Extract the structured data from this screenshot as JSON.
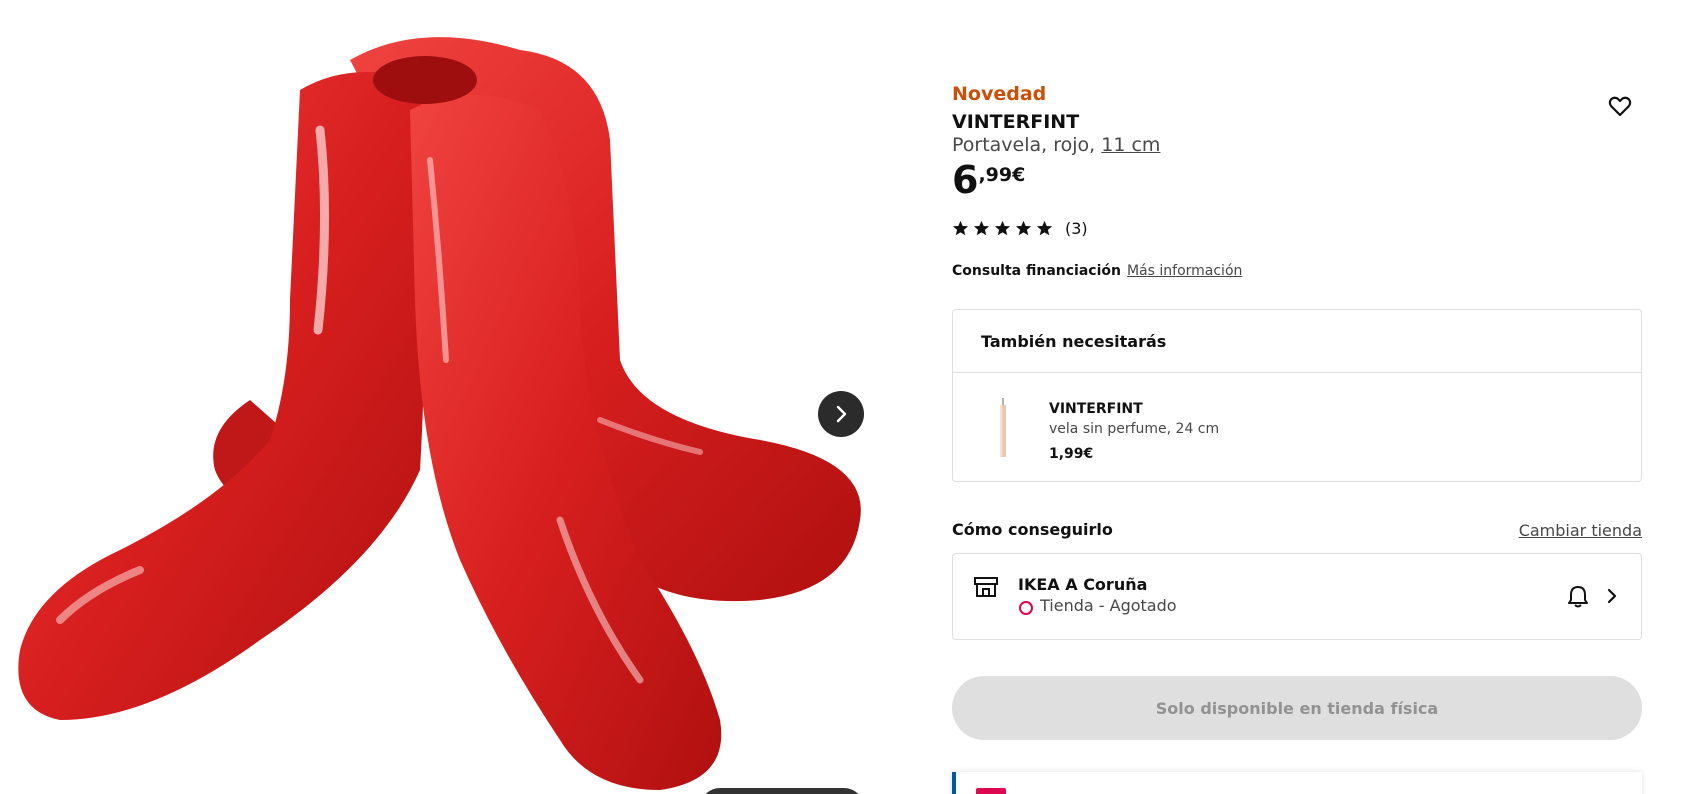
{
  "product": {
    "badge": "Novedad",
    "name": "VINTERFINT",
    "description": "Portavela, rojo, ",
    "size_link": "11 cm",
    "price_integer": "6",
    "price_decimal": ",99€",
    "rating": {
      "stars": 5,
      "max_stars": 5,
      "count_label": "(3)"
    },
    "image_icon": "candle-holder-photo"
  },
  "financing": {
    "label": "Consulta financiación",
    "link": "Más información"
  },
  "also_needed": {
    "title": "También necesitarás",
    "items": [
      {
        "name": "VINTERFINT",
        "description": "vela sin perfume, 24 cm",
        "price": "1,99€"
      }
    ]
  },
  "availability": {
    "title": "Cómo conseguirlo",
    "change_store_label": "Cambiar tienda",
    "store_name": "IKEA A Coruña",
    "store_status": "Tienda - Agotado",
    "status_color": "#e00751"
  },
  "cta": {
    "label": "Solo disponible en tienda física"
  },
  "icons": {
    "wishlist": "heart-icon",
    "next": "chevron-right-icon",
    "store": "store-icon",
    "notify": "bell-icon"
  },
  "colors": {
    "badge": "#ca5008",
    "product_red": "#d81f1f",
    "cta_disabled": "#dfdfdf",
    "accent_blue": "#0058a3"
  }
}
